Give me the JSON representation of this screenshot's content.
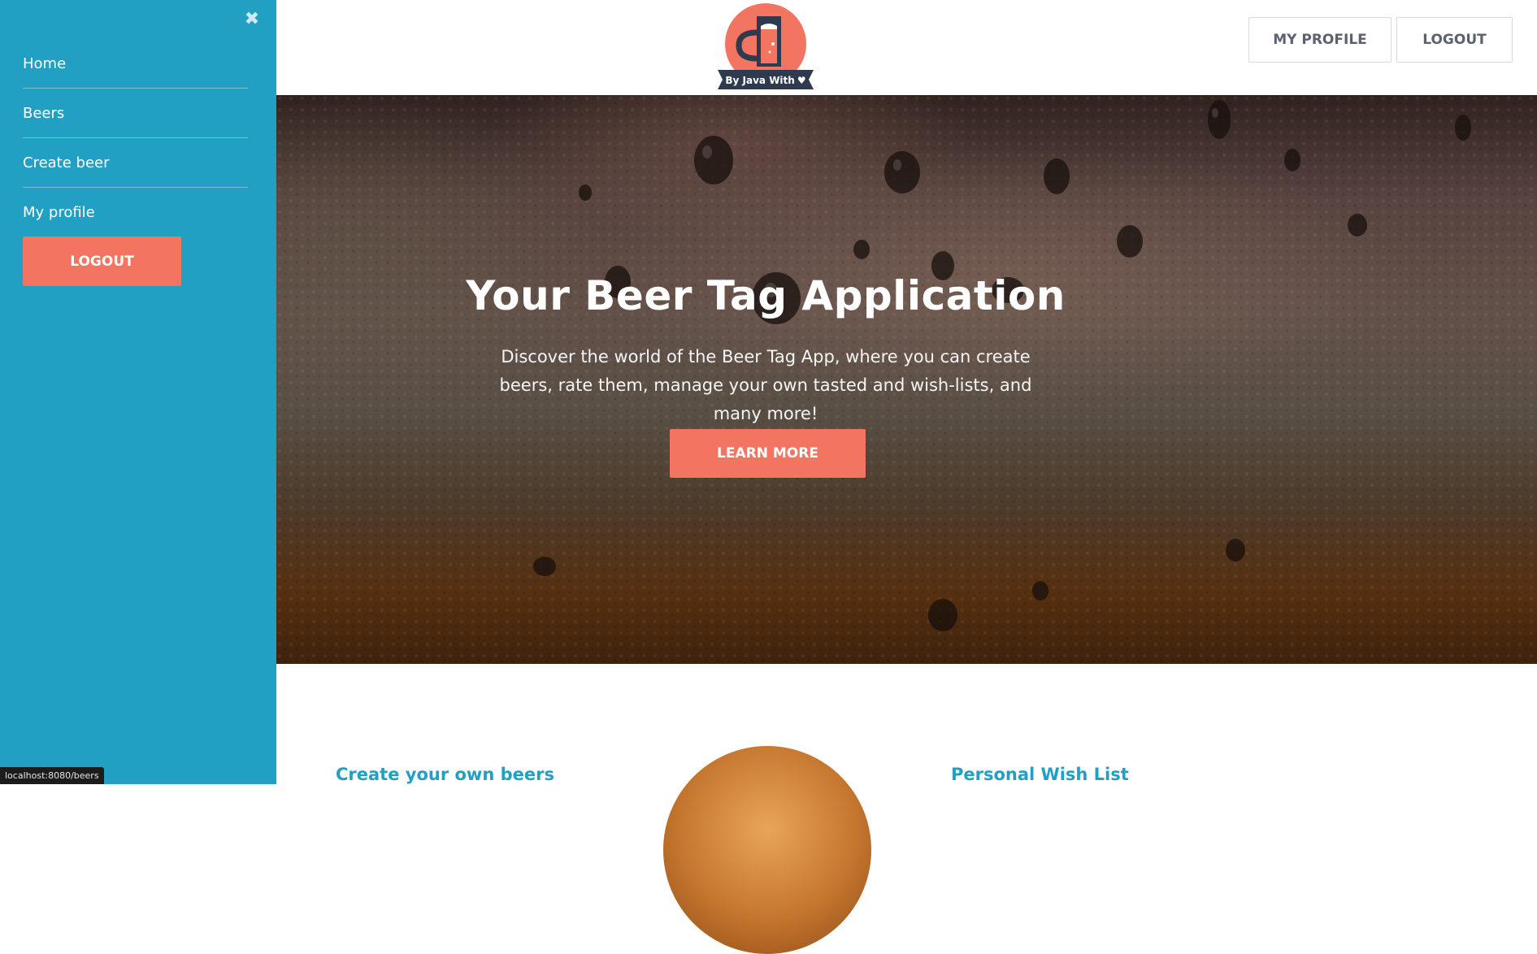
{
  "sidebar": {
    "close_glyph": "✖",
    "items": [
      {
        "label": "Home"
      },
      {
        "label": "Beers"
      },
      {
        "label": "Create beer"
      },
      {
        "label": "My profile"
      }
    ],
    "logout_label": "LOGOUT"
  },
  "header": {
    "logo_text": "By Java With",
    "profile_label": "MY PROFILE",
    "logout_label": "LOGOUT"
  },
  "hero": {
    "title": "Your Beer Tag Application",
    "text": "Discover the world of the Beer Tag App, where you can create beers, rate them, manage your own tasted and wish-lists, and many more!",
    "button_label": "LEARN MORE"
  },
  "features": {
    "left_title": "Create your own beers",
    "right_title": "Personal Wish List"
  },
  "status_url": "localhost:8080/beers",
  "colors": {
    "sidebar": "#22a0c4",
    "accent": "#f37461",
    "logo_dark": "#2e3b4e"
  }
}
